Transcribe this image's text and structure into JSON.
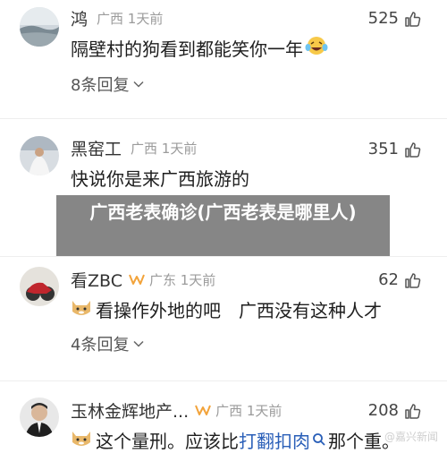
{
  "comments": [
    {
      "user": "鸿",
      "region": "广西 1天前",
      "likes": "525",
      "text": "隔壁村的狗看到都能笑你一年",
      "emoji": "laughing-crying-emoji",
      "replies": "8条回复"
    },
    {
      "user": "黑窑工",
      "region": "广西 1天前",
      "likes": "351",
      "text": "快说你是来广西旅游的"
    },
    {
      "user": "看ZBC",
      "region": "广东 1天前",
      "likes": "62",
      "text": "看操作外地的吧　广西没有这种人才",
      "emoji": "doge-emoji",
      "replies": "4条回复"
    },
    {
      "user": "玉林金辉地产...",
      "region": "广西 1天前",
      "likes": "208",
      "text_prefix": "这个量刑。应该比",
      "text_link": "打翻扣肉",
      "text_suffix": "那个重。",
      "emoji": "doge-emoji"
    }
  ],
  "overlay_title": "广西老表确诊(广西老表是哪里人)",
  "watermark": "@嘉兴新闻",
  "icons": {
    "like": "thumbs-up-icon",
    "chevron": "chevron-down-icon",
    "badge": "verified-badge-icon"
  },
  "colors": {
    "badge": "#f2a33a",
    "link": "#2a5fb8",
    "overlay": "#646464"
  }
}
